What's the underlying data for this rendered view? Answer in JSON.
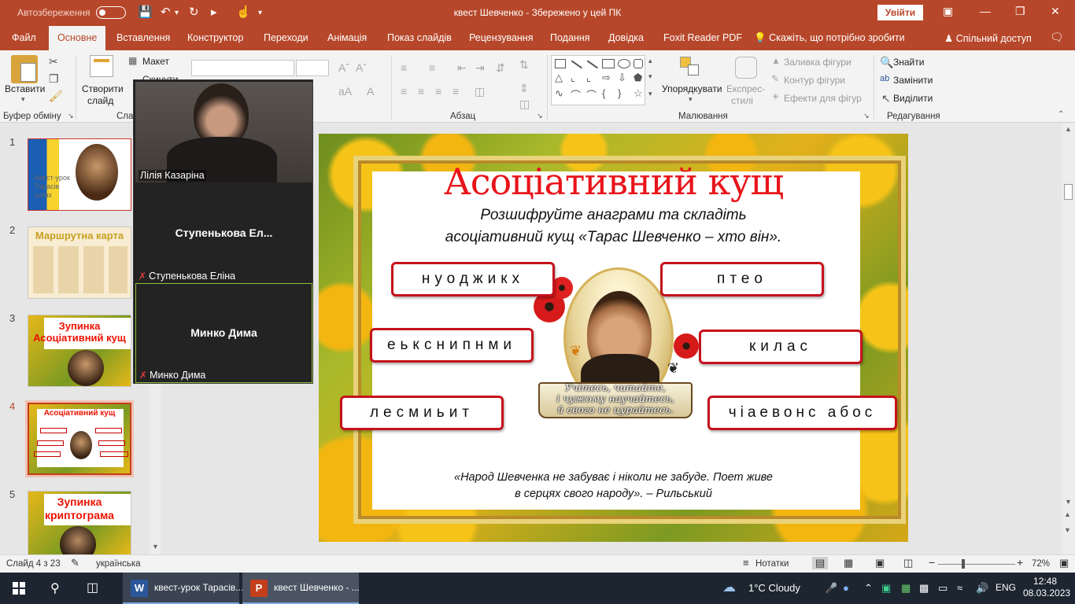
{
  "window": {
    "autosave_label": "Автозбереження",
    "title": "квест Шевченко  -  Збережено у цей ПК",
    "signin": "Увійти"
  },
  "tabs": [
    {
      "label": "Файл"
    },
    {
      "label": "Основне"
    },
    {
      "label": "Вставлення"
    },
    {
      "label": "Конструктор"
    },
    {
      "label": "Переходи"
    },
    {
      "label": "Анімація"
    },
    {
      "label": "Показ слайдів"
    },
    {
      "label": "Рецензування"
    },
    {
      "label": "Подання"
    },
    {
      "label": "Довідка"
    },
    {
      "label": "Foxit Reader PDF"
    }
  ],
  "tellme": "Скажіть, що потрібно зробити",
  "share": "Спільний доступ",
  "ribbon": {
    "paste": "Вставити",
    "clipboard": "Буфер обміну",
    "new_slide_1": "Створити",
    "new_slide_2": "слайд",
    "layout": "Макет",
    "reset": "Скинути",
    "slides_group": "Сла",
    "paragraph": "Абзац",
    "arrange": "Упорядкувати",
    "quick_styles_1": "Експрес-",
    "quick_styles_2": "стилі",
    "shape_fill": "Заливка фігури",
    "shape_outline": "Контур фігури",
    "shape_effects": "Ефекти для фігур",
    "drawing": "Малювання",
    "find": "Знайти",
    "replace": "Замінити",
    "select": "Виділити",
    "editing": "Редагування"
  },
  "thumbnails": [
    {
      "num": "1",
      "text": "Квест-урок Тарасів шлях"
    },
    {
      "num": "2",
      "text": "Маршрутна карта"
    },
    {
      "num": "3",
      "text": "Зупинка Асоціативний кущ"
    },
    {
      "num": "4",
      "text": "Асоціативний кущ"
    },
    {
      "num": "5",
      "text": "Зупинка криптограма"
    }
  ],
  "call": {
    "p1": "Лілія Казаріна",
    "p2_name": "Ступенькова  Ел...",
    "p2_label": "Ступенькова Еліна",
    "p3_name": "Минко Дима",
    "p3_label": "Минко Дима"
  },
  "slide": {
    "title": "Асоціативний кущ",
    "subtitle_1": "Розшифруйте анаграми та складіть",
    "subtitle_2": "асоціативний кущ «Тарас Шевченко – хто він».",
    "anagrams": [
      "нуоджикх",
      "птео",
      "еькснипнми",
      "килас",
      "лесмиьит",
      "чіаевонс  абос"
    ],
    "book_1": "Учітесь, читайте,",
    "book_2": "і чужому научайтесь,",
    "book_3": "й свого не цурайтесь.",
    "quote_1": "«Народ Шевченка не забуває і ніколи не забуде. Поет живе",
    "quote_2": "в серцях свого народу». – Рильський"
  },
  "status": {
    "slide": "Слайд 4 з 23",
    "lang": "українська",
    "notes": "Нотатки",
    "zoom": "72%"
  },
  "taskbar": {
    "app1": "квест-урок Тарасів...",
    "app2": "квест Шевченко - ...",
    "weather": "1°C  Cloudy",
    "lang": "ENG",
    "time": "12:48",
    "date": "08.03.2023"
  },
  "colors": {
    "brand": "#b7472a",
    "anagram_border": "#c6121b",
    "title_red": "#e8141a"
  }
}
